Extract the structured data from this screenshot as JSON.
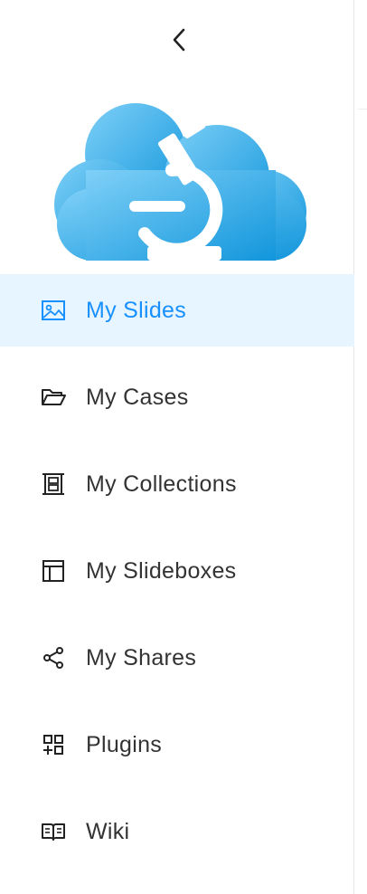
{
  "sidebar": {
    "collapse_icon": "chevron-left-icon",
    "logo_icon": "cloud-microscope-logo",
    "colors": {
      "accent": "#1890ff",
      "active_bg": "#e6f5ff",
      "text": "#333333",
      "logo_light": "#6ec6f5",
      "logo_dark": "#1aa3e4"
    },
    "items": [
      {
        "label": "My Slides",
        "icon": "image-icon",
        "active": true
      },
      {
        "label": "My Cases",
        "icon": "folder-open-icon",
        "active": false
      },
      {
        "label": "My Collections",
        "icon": "collection-icon",
        "active": false
      },
      {
        "label": "My Slideboxes",
        "icon": "slidebox-icon",
        "active": false
      },
      {
        "label": "My Shares",
        "icon": "share-icon",
        "active": false
      },
      {
        "label": "Plugins",
        "icon": "plugins-icon",
        "active": false
      },
      {
        "label": "Wiki",
        "icon": "book-icon",
        "active": false
      }
    ]
  }
}
